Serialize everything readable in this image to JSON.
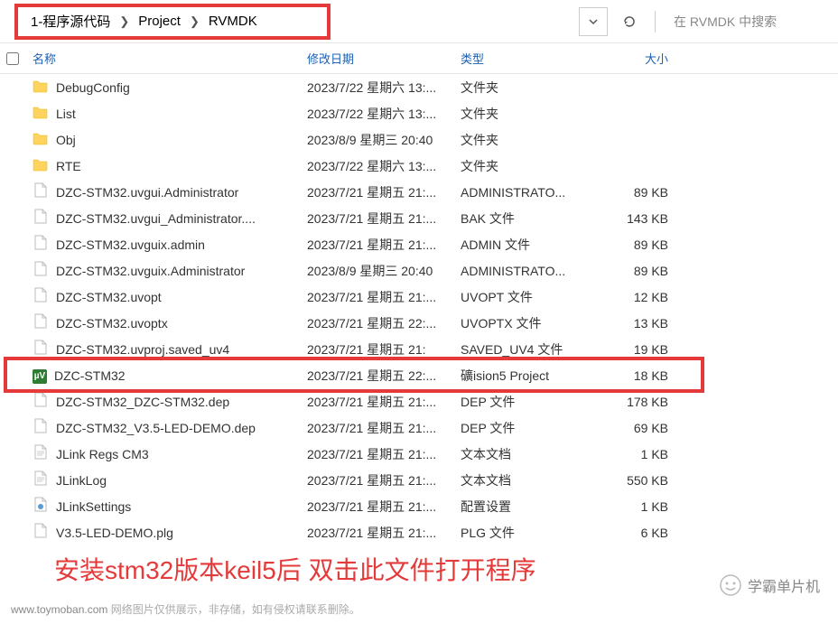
{
  "breadcrumb": [
    "1-程序源代码",
    "Project",
    "RVMDK"
  ],
  "search_placeholder": "在 RVMDK 中搜索",
  "columns": {
    "name": "名称",
    "date": "修改日期",
    "type": "类型",
    "size": "大小"
  },
  "files": [
    {
      "name": "DebugConfig",
      "date": "2023/7/22 星期六 13:...",
      "type": "文件夹",
      "size": "",
      "icon": "folder"
    },
    {
      "name": "List",
      "date": "2023/7/22 星期六 13:...",
      "type": "文件夹",
      "size": "",
      "icon": "folder"
    },
    {
      "name": "Obj",
      "date": "2023/8/9 星期三 20:40",
      "type": "文件夹",
      "size": "",
      "icon": "folder"
    },
    {
      "name": "RTE",
      "date": "2023/7/22 星期六 13:...",
      "type": "文件夹",
      "size": "",
      "icon": "folder"
    },
    {
      "name": "DZC-STM32.uvgui.Administrator",
      "date": "2023/7/21 星期五 21:...",
      "type": "ADMINISTRATO...",
      "size": "89 KB",
      "icon": "file"
    },
    {
      "name": "DZC-STM32.uvgui_Administrator....",
      "date": "2023/7/21 星期五 21:...",
      "type": "BAK 文件",
      "size": "143 KB",
      "icon": "file"
    },
    {
      "name": "DZC-STM32.uvguix.admin",
      "date": "2023/7/21 星期五 21:...",
      "type": "ADMIN 文件",
      "size": "89 KB",
      "icon": "file"
    },
    {
      "name": "DZC-STM32.uvguix.Administrator",
      "date": "2023/8/9 星期三 20:40",
      "type": "ADMINISTRATO...",
      "size": "89 KB",
      "icon": "file"
    },
    {
      "name": "DZC-STM32.uvopt",
      "date": "2023/7/21 星期五 21:...",
      "type": "UVOPT 文件",
      "size": "12 KB",
      "icon": "file"
    },
    {
      "name": "DZC-STM32.uvoptx",
      "date": "2023/7/21 星期五 22:...",
      "type": "UVOPTX 文件",
      "size": "13 KB",
      "icon": "file"
    },
    {
      "name": "DZC-STM32.uvproj.saved_uv4",
      "date": "2023/7/21 星期五 21:",
      "type": "SAVED_UV4 文件",
      "size": "19 KB",
      "icon": "file"
    },
    {
      "name": "DZC-STM32",
      "date": "2023/7/21 星期五 22:...",
      "type": "礦ision5 Project",
      "size": "18 KB",
      "icon": "keil",
      "highlight": true
    },
    {
      "name": "DZC-STM32_DZC-STM32.dep",
      "date": "2023/7/21 星期五 21:...",
      "type": "DEP 文件",
      "size": "178 KB",
      "icon": "file"
    },
    {
      "name": "DZC-STM32_V3.5-LED-DEMO.dep",
      "date": "2023/7/21 星期五 21:...",
      "type": "DEP 文件",
      "size": "69 KB",
      "icon": "file"
    },
    {
      "name": "JLink Regs CM3",
      "date": "2023/7/21 星期五 21:...",
      "type": "文本文档",
      "size": "1 KB",
      "icon": "text"
    },
    {
      "name": "JLinkLog",
      "date": "2023/7/21 星期五 21:...",
      "type": "文本文档",
      "size": "550 KB",
      "icon": "text"
    },
    {
      "name": "JLinkSettings",
      "date": "2023/7/21 星期五 21:...",
      "type": "配置设置",
      "size": "1 KB",
      "icon": "cfg"
    },
    {
      "name": "V3.5-LED-DEMO.plg",
      "date": "2023/7/21 星期五 21:...",
      "type": "PLG 文件",
      "size": "6 KB",
      "icon": "file"
    }
  ],
  "annotation": "安装stm32版本keil5后  双击此文件打开程序",
  "watermark_brand": "学霸单片机",
  "footer": {
    "domain": "www.toymoban.com",
    "text": "网络图片仅供展示，非存储，如有侵权请联系删除。"
  }
}
